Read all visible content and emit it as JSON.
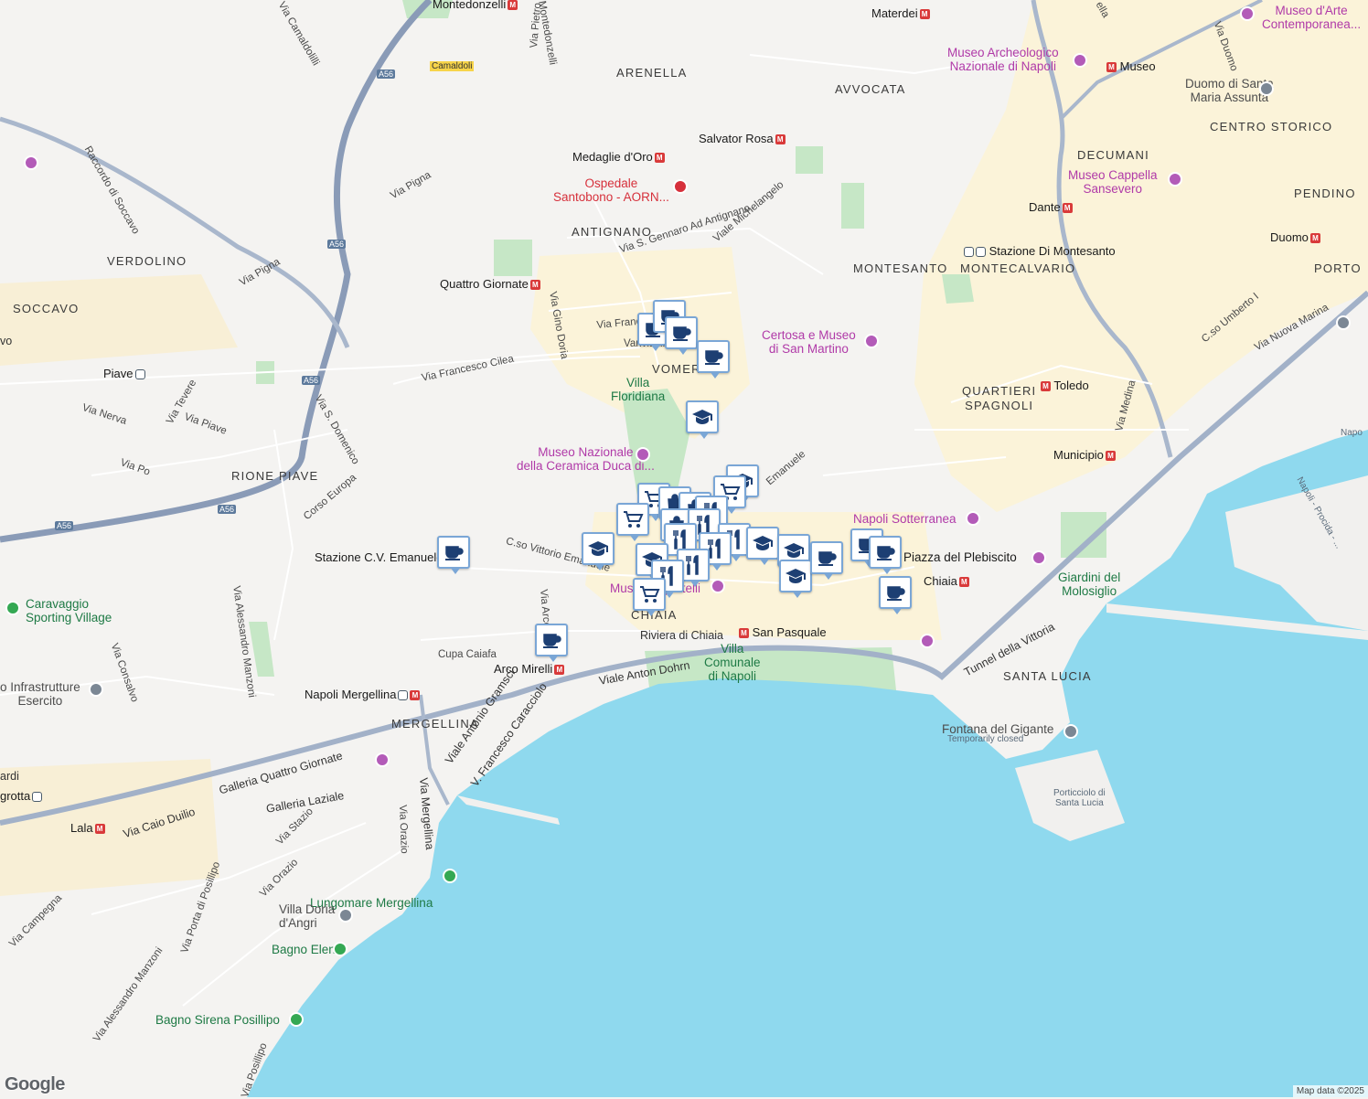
{
  "map": {
    "districts": [
      {
        "id": "arenella",
        "text": "ARENELLA"
      },
      {
        "id": "avvocata",
        "text": "AVVOCATA"
      },
      {
        "id": "centro-storico",
        "text": "CENTRO STORICO"
      },
      {
        "id": "decumani",
        "text": "DECUMANI"
      },
      {
        "id": "pendino",
        "text": "PENDINO"
      },
      {
        "id": "antignano",
        "text": "ANTIGNANO"
      },
      {
        "id": "verdolino",
        "text": "VERDOLINO"
      },
      {
        "id": "soccavo",
        "text": "SOCCAVO"
      },
      {
        "id": "montesanto",
        "text": "MONTESANTO"
      },
      {
        "id": "montecalvario",
        "text": "MONTECALVARIO"
      },
      {
        "id": "porto",
        "text": "PORTO"
      },
      {
        "id": "vomero",
        "text": "VOMERO"
      },
      {
        "id": "quartieri-spagnoli",
        "text": "QUARTIERI\nSPAGNOLI"
      },
      {
        "id": "rione-piave",
        "text": "RIONE PIAVE"
      },
      {
        "id": "chiaia",
        "text": "CHIAIA"
      },
      {
        "id": "santa-lucia",
        "text": "SANTA LUCIA"
      },
      {
        "id": "mergellina",
        "text": "MERGELLINA"
      }
    ],
    "metro_stations": [
      {
        "id": "montedonzelli",
        "text": "Montedonzelli"
      },
      {
        "id": "materdei",
        "text": "Materdei"
      },
      {
        "id": "museo",
        "text": "Museo"
      },
      {
        "id": "medaglie-doro",
        "text": "Medaglie d'Oro"
      },
      {
        "id": "salvator-rosa",
        "text": "Salvator Rosa"
      },
      {
        "id": "dante",
        "text": "Dante"
      },
      {
        "id": "duomo",
        "text": "Duomo"
      },
      {
        "id": "quattro-giornate",
        "text": "Quattro Giornate"
      },
      {
        "id": "toledo",
        "text": "Toledo"
      },
      {
        "id": "municipio",
        "text": "Municipio"
      },
      {
        "id": "chiaia-st",
        "text": "Chiaia"
      },
      {
        "id": "san-pasquale",
        "text": "San Pasquale"
      },
      {
        "id": "arco-mirelli",
        "text": "Arco Mirelli"
      },
      {
        "id": "lala",
        "text": "Lala"
      }
    ],
    "train_stations": [
      {
        "id": "stazione-montesanto",
        "text": "Stazione Di Montesanto"
      },
      {
        "id": "piave",
        "text": "Piave"
      },
      {
        "id": "napoli-mergellina",
        "text": "Napoli Mergellina"
      },
      {
        "id": "stazione-cv-emanuele",
        "text": "Stazione C.V. Emanuele"
      },
      {
        "id": "grotta",
        "text": "grotta"
      }
    ],
    "pois": [
      {
        "id": "museo-archeologico",
        "text": "Museo Archeologico\nNazionale di Napoli",
        "kind": "museum"
      },
      {
        "id": "museo-arte-contemporanea",
        "text": "Museo d'Arte\nContemporanea...",
        "kind": "museum"
      },
      {
        "id": "duomo-santa-maria",
        "text": "Duomo di Santa\nMaria Assunta",
        "kind": "gray"
      },
      {
        "id": "cappella-sansevero",
        "text": "Museo Cappella\nSansevero",
        "kind": "museum"
      },
      {
        "id": "ospedale-santobono",
        "text": "Ospedale\nSantobono - AORN...",
        "kind": "hospital"
      },
      {
        "id": "certosa-san-martino",
        "text": "Certosa e Museo\ndi San Martino",
        "kind": "museum"
      },
      {
        "id": "villa-floridiana",
        "text": "Villa\nFloridiana",
        "kind": "park"
      },
      {
        "id": "museo-ceramica",
        "text": "Museo Nazionale\ndella Ceramica Duca di...",
        "kind": "museum"
      },
      {
        "id": "napoli-sotterranea",
        "text": "Napoli Sotterranea",
        "kind": "museum"
      },
      {
        "id": "piazza-plebiscito",
        "text": "Piazza del Plebiscito",
        "kind": "museum"
      },
      {
        "id": "giardini-molosiglio",
        "text": "Giardini del\nMolosiglio",
        "kind": "park"
      },
      {
        "id": "villa-comunale",
        "text": "Villa\nComunale\ndi Napoli",
        "kind": "park"
      },
      {
        "id": "museo-pignatelli",
        "text": "Museo Pignatelli",
        "kind": "museum"
      },
      {
        "id": "caravaggio-sporting",
        "text": "Caravaggio\nSporting Village",
        "kind": "park"
      },
      {
        "id": "infrastrutture-esercito",
        "text": "o Infrastrutture\nEsercito",
        "kind": "gray"
      },
      {
        "id": "fontana-gigante",
        "text": "Fontana del Gigante",
        "kind": "gray"
      },
      {
        "id": "fontana-closed",
        "text": "Temporarily closed",
        "kind": "small"
      },
      {
        "id": "porticciolo",
        "text": "Porticciolo di\nSanta Lucia",
        "kind": "small"
      },
      {
        "id": "lungomare-mergellina",
        "text": "Lungomare Mergellina",
        "kind": "park"
      },
      {
        "id": "villa-doria",
        "text": "Villa Doria\nd'Angri",
        "kind": "gray"
      },
      {
        "id": "bagno-elena",
        "text": "Bagno Elena",
        "kind": "park"
      },
      {
        "id": "bagno-sirena",
        "text": "Bagno Sirena Posillipo",
        "kind": "park"
      },
      {
        "id": "napoli-procida",
        "text": "Napoli - Procida - ...",
        "kind": "small"
      },
      {
        "id": "napo",
        "text": "Napo",
        "kind": "small"
      },
      {
        "id": "camaldoli",
        "text": "Camaldoli",
        "kind": "small"
      }
    ],
    "streets": [
      {
        "id": "via-camaldolilli",
        "text": "Via Camaldolilli"
      },
      {
        "id": "via-pietro",
        "text": "Via Pietro"
      },
      {
        "id": "montedonzelli-st",
        "text": "Montedonzelli"
      },
      {
        "id": "raccordo-soccavo",
        "text": "Raccordo di Soccavo"
      },
      {
        "id": "via-pigna-1",
        "text": "Via Pigna"
      },
      {
        "id": "via-pigna-2",
        "text": "Via Pigna"
      },
      {
        "id": "via-sgennaro",
        "text": "Via S. Gennaro Ad Antignano"
      },
      {
        "id": "viale-michelangelo",
        "text": "Viale Michelangelo"
      },
      {
        "id": "via-gino-doria",
        "text": "Via Gino Doria"
      },
      {
        "id": "via-francesco-cilea",
        "text": "Via Francesco Cilea"
      },
      {
        "id": "via-franc",
        "text": "Via Franc"
      },
      {
        "id": "vanv",
        "text": "Vanvitelli"
      },
      {
        "id": "via-nerva",
        "text": "Via Nerva"
      },
      {
        "id": "via-tevere",
        "text": "Via Tevere"
      },
      {
        "id": "via-piave",
        "text": "Via Piave"
      },
      {
        "id": "via-s-domenico",
        "text": "Via S. Domenico"
      },
      {
        "id": "via-po",
        "text": "Via Po"
      },
      {
        "id": "corso-europa",
        "text": "Corso Europa"
      },
      {
        "id": "cso-vittorio",
        "text": "C.so Vittorio Emanuele"
      },
      {
        "id": "emanuele",
        "text": "Emanuele"
      },
      {
        "id": "via-alessandro-manzoni",
        "text": "Via Alessandro Manzoni"
      },
      {
        "id": "via-consalvo",
        "text": "Via Consalvo"
      },
      {
        "id": "via-arco",
        "text": "Via Arco"
      },
      {
        "id": "cupa-caiafa",
        "text": "Cupa Caiafa"
      },
      {
        "id": "riviera-chiaia",
        "text": "Riviera di Chiaia"
      },
      {
        "id": "viale-anton-dohrn",
        "text": "Viale Anton Dohrn"
      },
      {
        "id": "viale-gramsci",
        "text": "Viale Antonio Gramsci"
      },
      {
        "id": "v-caracciolo",
        "text": "V. Francesco Caracciolo"
      },
      {
        "id": "galleria-quattro",
        "text": "Galleria Quattro Giornate"
      },
      {
        "id": "galleria-laziale",
        "text": "Galleria Laziale"
      },
      {
        "id": "via-caio-duilio",
        "text": "Via Caio Duilio"
      },
      {
        "id": "via-stazio",
        "text": "Via Stazio"
      },
      {
        "id": "via-orazio-1",
        "text": "Via Orazio"
      },
      {
        "id": "via-orazio-2",
        "text": "Via Orazio"
      },
      {
        "id": "via-mergellina",
        "text": "Via Mergellina"
      },
      {
        "id": "via-campegna",
        "text": "Via Campegna"
      },
      {
        "id": "via-porta-posillipo",
        "text": "Via Porta di Posillipo"
      },
      {
        "id": "via-manzoni-2",
        "text": "Via Alessandro Manzoni"
      },
      {
        "id": "via-posillipo",
        "text": "Via Posillipo"
      },
      {
        "id": "tunnel-vittoria",
        "text": "Tunnel della Vittoria"
      },
      {
        "id": "via-medina",
        "text": "Via Medina"
      },
      {
        "id": "cso-umberto",
        "text": "C.so Umberto I"
      },
      {
        "id": "via-nuova-marina",
        "text": "Via Nuova Marina"
      },
      {
        "id": "via-duomo",
        "text": "Via Duomo"
      },
      {
        "id": "ella",
        "text": "ella"
      },
      {
        "id": "ardi",
        "text": "ardi"
      },
      {
        "id": "vo",
        "text": "vo"
      }
    ],
    "road_shields": [
      {
        "id": "a56-1",
        "text": "A56"
      },
      {
        "id": "a56-2",
        "text": "A56"
      },
      {
        "id": "a56-3",
        "text": "A56"
      },
      {
        "id": "a56-4",
        "text": "A56"
      },
      {
        "id": "a56-5",
        "text": "A56"
      }
    ],
    "attribution": "Map data ©2025",
    "logo": "Google",
    "colors": {
      "water": "#8fd9ee",
      "land": "#f4f3f1",
      "park": "#c5e8c9",
      "urban": "#fbf4dc",
      "highway": "#8a9bb7",
      "marker_border": "#7aa6d6",
      "marker_icon": "#1d3f73"
    },
    "marker_icons": [
      "cafe-icon",
      "school-icon",
      "grocery-cart-icon",
      "restaurant-icon",
      "shopping-bag-icon"
    ]
  }
}
